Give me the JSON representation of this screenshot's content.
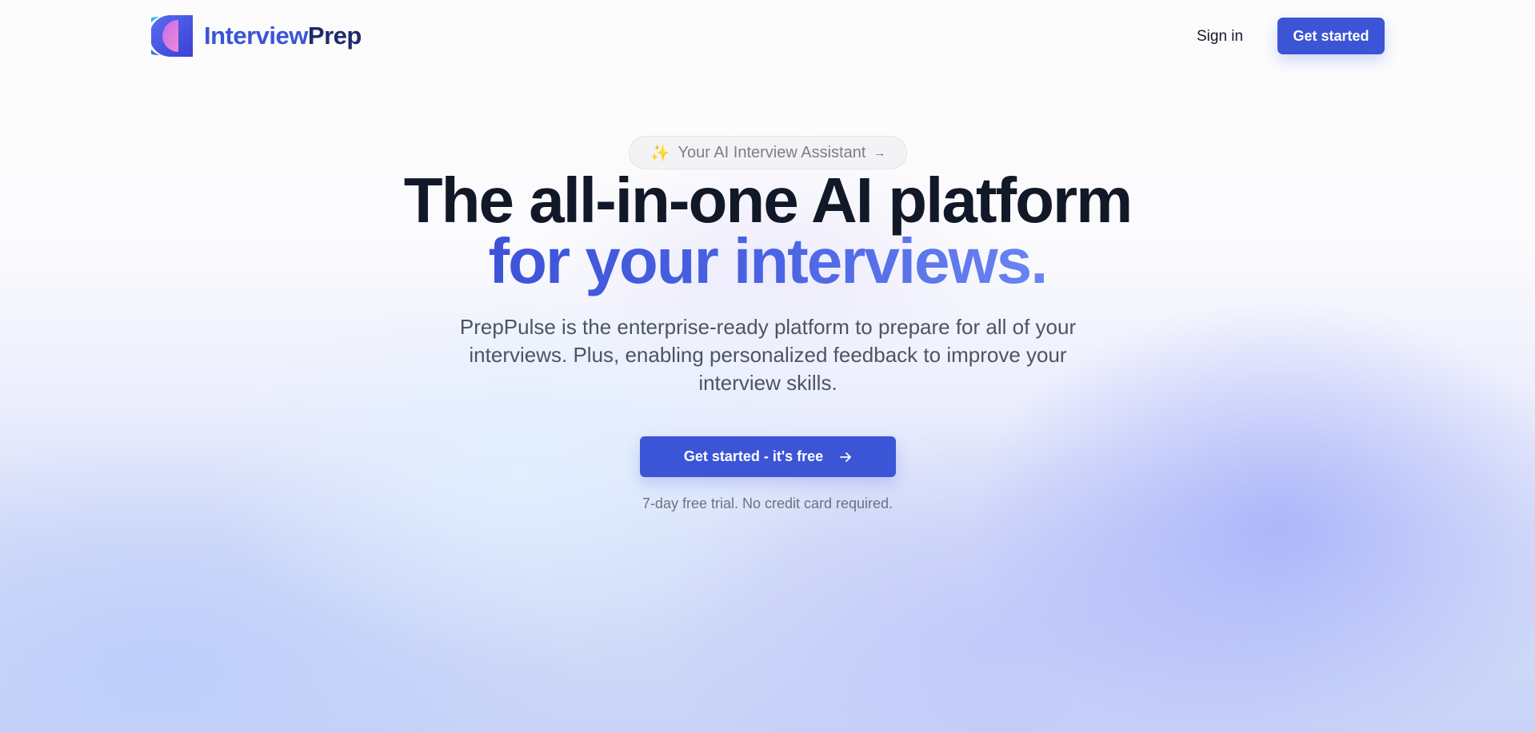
{
  "nav": {
    "logo_icon": "gradient-arc-logo-icon",
    "logo_text_primary": "Interview",
    "logo_text_secondary": "Prep",
    "signin_label": "Sign in",
    "cta_label": "Get started"
  },
  "hero": {
    "badge": {
      "icon": "sparkles-icon",
      "icon_glyph": "✨",
      "label": "Your AI Interview Assistant",
      "arrow_glyph": "→"
    },
    "headline_line1": "The all-in-one AI platform",
    "headline_line2": "for your interviews.",
    "subheading": "PrepPulse is the enterprise-ready platform to prepare for all of your interviews. Plus, enabling personalized feedback to improve your interview skills.",
    "cta_label": "Get started - it's free",
    "cta_icon": "arrow-right-icon",
    "note": "7-day free trial. No credit card required."
  },
  "colors": {
    "brand": "#3b55d6",
    "brand_dark": "#1e2a6b",
    "heading": "#111827",
    "body_text": "#4b5563"
  }
}
